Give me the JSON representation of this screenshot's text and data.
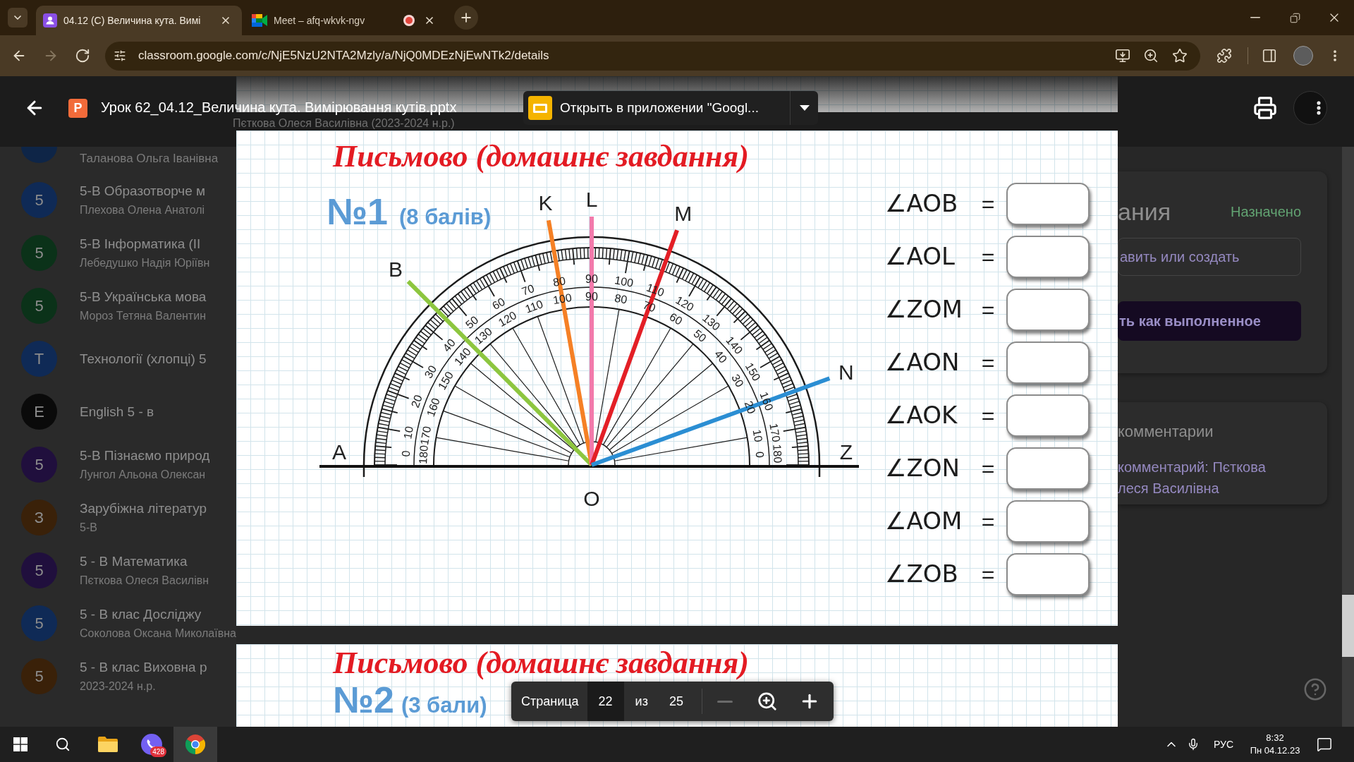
{
  "browser": {
    "tabs": [
      {
        "kind": "classroom",
        "title": "04.12 (С) Величина кута. Вимі",
        "selected": true,
        "recording": false
      },
      {
        "kind": "meet",
        "title": "Meet – afq-wkvk-ngv",
        "selected": false,
        "recording": true
      }
    ],
    "nav_buttons": [
      {
        "kind": "back",
        "disabled": false
      },
      {
        "kind": "forward",
        "disabled": true
      },
      {
        "kind": "reload",
        "disabled": false
      }
    ],
    "url": "classroom.google.com/c/NjE5NzU2NTA2Mzly/a/NjQ0MDEzNjEwNTk2/details"
  },
  "viewer": {
    "file_type": "P",
    "file_name": "Урок 62_04.12_Величина кута. Вимірювання кутів.pptx",
    "open_button": "Открыть в приложении \"Googl..."
  },
  "classroom": {
    "course_subtitle": "Пєткова Олеся Василівна (2023-2024 н.р.)",
    "partial_class": {
      "subtitle": "Таланова Ольга Іванівна",
      "color": "#0e2547"
    },
    "classes": [
      {
        "title": "5-В Образотворче м",
        "subtitle": "Плехова Олена Анатолі",
        "letter": "5",
        "color": "#0f2a56"
      },
      {
        "title": "5-В Інформатика (II",
        "subtitle": "Лебедушко Надія Юріївн",
        "letter": "5",
        "color": "#0b3219"
      },
      {
        "title": "5-В Українська мова",
        "subtitle": "Мороз Тетяна Валентин",
        "letter": "5",
        "color": "#0b3219"
      },
      {
        "title": "Технології (хлопці) 5",
        "letter": "Т",
        "color": "#0f2a56"
      },
      {
        "title": "English 5 - в",
        "letter": "E",
        "color": "#0a0a0a"
      },
      {
        "title": "5-В Пізнаємо природ",
        "subtitle": "Лунгол Альона Олексан",
        "letter": "5",
        "color": "#200f3d"
      },
      {
        "title": "Зарубіжна літератур",
        "subtitle": "5-В",
        "letter": "З",
        "color": "#3a2109"
      },
      {
        "title": "5 - В Математика",
        "subtitle": "Пєткова Олеся Василівн",
        "letter": "5",
        "color": "#200f3d"
      },
      {
        "title": "5 - В клас Досліджу",
        "subtitle": "Соколова Оксана Миколаївна",
        "letter": "5",
        "color": "#0f2a56"
      },
      {
        "title": "5 - В клас Виховна р",
        "subtitle": "2023-2024 н.р.",
        "letter": "5",
        "color": "#3a2109"
      }
    ],
    "panel": {
      "title": "ания",
      "status": "Назначено",
      "add_button": "авить или создать",
      "done_button": "ть как выполненное"
    },
    "comments": {
      "title": "комментарии",
      "lines": [
        "комментарий: Пєткова",
        "леся Василівна"
      ]
    }
  },
  "current_slide": {
    "title": "Письмово (домашнє завдання)",
    "task": "№1",
    "points": "(8 балів)",
    "protractor": {
      "outer_scale": [
        "0",
        "10",
        "20",
        "30",
        "40",
        "50",
        "60",
        "70",
        "80",
        "90",
        "100",
        "110",
        "120",
        "130",
        "140",
        "150",
        "160",
        "170",
        "180"
      ],
      "inner_scale": [
        "180",
        "170",
        "160",
        "150",
        "140",
        "130",
        "120",
        "110",
        "100",
        "90",
        "80",
        "70",
        "60",
        "50",
        "40",
        "30",
        "20",
        "10",
        "0"
      ],
      "side_labels": [
        "A",
        "Z"
      ],
      "center_label": "O",
      "rays": [
        {
          "label": "B",
          "color": "#8dc63f"
        },
        {
          "label": "K",
          "color": "#f58025"
        },
        {
          "label": "L",
          "color": "#f27aab"
        },
        {
          "label": "M",
          "color": "#e31f26"
        },
        {
          "label": "N",
          "color": "#2b8ed3"
        }
      ]
    },
    "answers": [
      {
        "label": "∠AOB",
        "sign": "="
      },
      {
        "label": "∠AOL",
        "sign": "="
      },
      {
        "label": "∠ZOM",
        "sign": "="
      },
      {
        "label": "∠AON",
        "sign": "="
      },
      {
        "label": "∠AOK",
        "sign": "="
      },
      {
        "label": "∠ZON",
        "sign": "="
      },
      {
        "label": "∠AOM",
        "sign": "="
      },
      {
        "label": "∠ZOB",
        "sign": "="
      }
    ]
  },
  "next_slide": {
    "title": "Письмово (домашнє завдання)",
    "task": "№2",
    "points": "(3 бали)"
  },
  "page_nav": {
    "label": "Страница",
    "current": "22",
    "of": "из",
    "total": "25",
    "zoom_out_disabled": true
  },
  "taskbar": {
    "apps": [
      {
        "kind": "folder",
        "active": false
      },
      {
        "kind": "messenger",
        "active": false,
        "badge": "428"
      },
      {
        "kind": "browser",
        "active": true
      }
    ],
    "language": "РУС",
    "time": "8:32",
    "date": "Пн 04.12.23"
  }
}
